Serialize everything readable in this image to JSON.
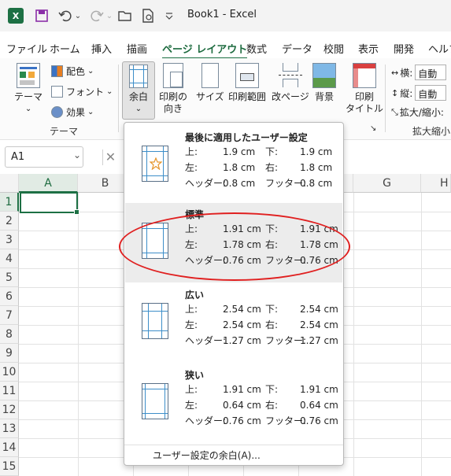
{
  "titlebar": {
    "app_icon": "X",
    "title": "Book1  -  Excel",
    "icons": [
      "save-icon",
      "undo-icon",
      "redo-icon",
      "open-folder-icon",
      "print-preview-icon",
      "customize-qat-icon"
    ]
  },
  "tabs": [
    "ファイル",
    "ホーム",
    "挿入",
    "描画",
    "ページ レイアウト",
    "数式",
    "データ",
    "校閲",
    "表示",
    "開発",
    "ヘルプ"
  ],
  "active_tab": "ページ レイアウト",
  "ribbon": {
    "theme": {
      "label": "テーマ",
      "dropdown": "⌄",
      "colors": "配色",
      "fonts": "フォント",
      "effects": "効果",
      "group": "テーマ"
    },
    "margins": {
      "label": "余白",
      "dropdown": "⌄"
    },
    "orientation": {
      "line1": "印刷の",
      "line2": "向き"
    },
    "size": {
      "label": "サイズ"
    },
    "print_area": {
      "label": "印刷範囲"
    },
    "breaks": {
      "label": "改ページ"
    },
    "background": {
      "label": "背景"
    },
    "print_titles": {
      "line1": "印刷",
      "line2": "タイトル"
    },
    "scale": {
      "width_label": "横:",
      "width_value": "自動",
      "height_label": "縦:",
      "height_value": "自動",
      "scale_label": "拡大/縮小:",
      "group": "拡大縮小"
    }
  },
  "namebox": {
    "value": "A1",
    "dropdown": "⌄"
  },
  "formula_bar": {
    "cancel": "✕"
  },
  "grid": {
    "columns": [
      "A",
      "B",
      "C",
      "D",
      "E",
      "F",
      "G",
      "H"
    ],
    "rows": [
      "1",
      "2",
      "3",
      "4",
      "5",
      "6",
      "7",
      "8",
      "9",
      "10",
      "11",
      "12",
      "13",
      "14",
      "15"
    ]
  },
  "margin_menu": {
    "options": [
      {
        "name": "最後に適用したユーザー設定",
        "top_label": "上:",
        "top": "1.9 cm",
        "bottom_label": "下:",
        "bottom": "1.9 cm",
        "left_label": "左:",
        "left": "1.8 cm",
        "right_label": "右:",
        "right": "1.8 cm",
        "header_label": "ヘッダー:",
        "header": "0.8 cm",
        "footer_label": "フッター:",
        "footer": "0.8 cm",
        "icon": "star-icon"
      },
      {
        "name": "標準",
        "top_label": "上:",
        "top": "1.91 cm",
        "bottom_label": "下:",
        "bottom": "1.91 cm",
        "left_label": "左:",
        "left": "1.78 cm",
        "right_label": "右:",
        "right": "1.78 cm",
        "header_label": "ヘッダー:",
        "header": "0.76 cm",
        "footer_label": "フッター:",
        "footer": "0.76 cm"
      },
      {
        "name": "広い",
        "top_label": "上:",
        "top": "2.54 cm",
        "bottom_label": "下:",
        "bottom": "2.54 cm",
        "left_label": "左:",
        "left": "2.54 cm",
        "right_label": "右:",
        "right": "2.54 cm",
        "header_label": "ヘッダー:",
        "header": "1.27 cm",
        "footer_label": "フッター:",
        "footer": "1.27 cm"
      },
      {
        "name": "狭い",
        "top_label": "上:",
        "top": "1.91 cm",
        "bottom_label": "下:",
        "bottom": "1.91 cm",
        "left_label": "左:",
        "left": "0.64 cm",
        "right_label": "右:",
        "right": "0.64 cm",
        "header_label": "ヘッダー:",
        "header": "0.76 cm",
        "footer_label": "フッター:",
        "footer": "0.76 cm"
      }
    ],
    "custom": "ユーザー設定の余白(A)..."
  },
  "colors": {
    "accent": "#1d7044",
    "highlight_ellipse": "#e02020",
    "margin_line": "#3d8ec9"
  }
}
